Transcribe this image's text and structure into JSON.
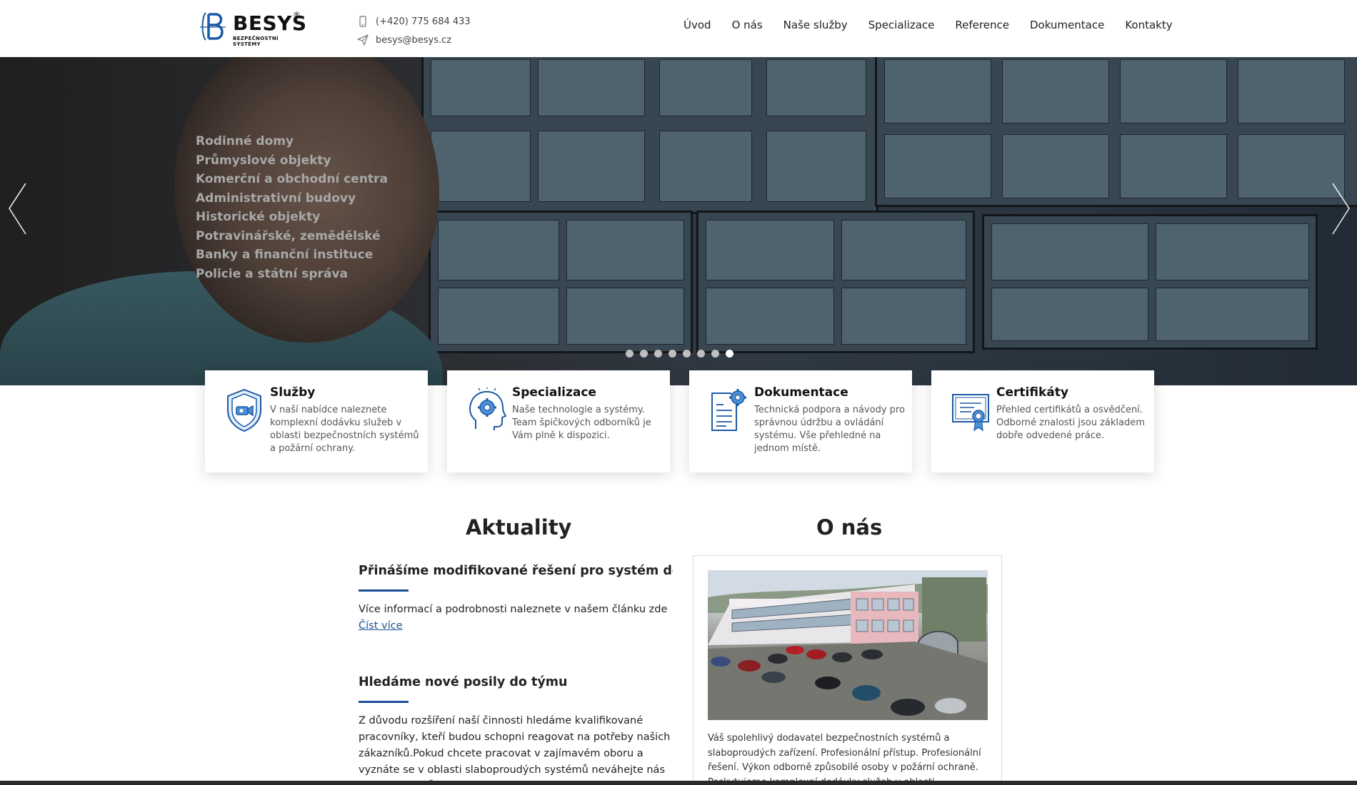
{
  "header": {
    "logo_text": "BESYS",
    "logo_reg": "®",
    "logo_tagline": "BEZPEČNOSTNÍ SYSTÉMY",
    "phone": "(+420) 775 684 433",
    "email": "besys@besys.cz",
    "nav": [
      "Úvod",
      "O nás",
      "Naše služby",
      "Specializace",
      "Reference",
      "Dokumentace",
      "Kontakty"
    ]
  },
  "hero": {
    "items": [
      "Rodinné domy",
      "Průmyslové objekty",
      "Komerční a obchodní centra",
      "Administrativní budovy",
      "Historické objekty",
      "Potravinářské, zemědělské",
      "Banky a finanční instituce",
      "Policie a státní správa"
    ],
    "slide_count": 8,
    "active_slide": 8
  },
  "cards": [
    {
      "title": "Služby",
      "text": "V naší nabídce naleznete komplexní dodávku služeb v oblasti bezpečnostních systémů a požární ochrany.",
      "icon": "shield-camera-icon"
    },
    {
      "title": "Specializace",
      "text": "Naše technologie a systémy. Team špičkových odborníků je Vám plně k dispozici.",
      "icon": "head-gear-icon"
    },
    {
      "title": "Dokumentace",
      "text": "Technická podpora a návody pro správnou údržbu a ovládání systému. Vše přehledné na jednom místě.",
      "icon": "document-gear-icon"
    },
    {
      "title": "Certifikáty",
      "text": "Přehled certifikátů a osvědčení. Odborné znalosti jsou základem dobře odvedené práce.",
      "icon": "certificate-icon"
    }
  ],
  "news": {
    "title": "Aktuality",
    "items": [
      {
        "heading": "Přinášíme modifikované řešení pro systém det..",
        "text": "Více informací  a podrobnosti naleznete v našem článku zde",
        "link": "Číst více"
      },
      {
        "heading": "Hledáme nové posily do týmu",
        "text": "Z důvodu rozšíření naší činnosti hledáme kvalifikované pracovníky, kteří budou schopni reagovat na potřeby našich zákazníků.Pokud chcete pracovat v zajímavém oboru a vyznáte se v oblasti slaboproudých systémů neváhejte nás kontaktovat. Číst více",
        "link": "Číst více"
      }
    ]
  },
  "about": {
    "title": "O nás",
    "text": "Váš spolehlivý dodavatel bezpečnostních systémů a slaboproudých zařízení. Profesionální přístup. Profesionální řešení. Výkon odborně způsobilé osoby v požární ochraně. Poskytujeme komplexní dodávky služeb v oblasti"
  },
  "colors": {
    "accent": "#1c4f96",
    "logo_blue": "#1a5aa6"
  }
}
